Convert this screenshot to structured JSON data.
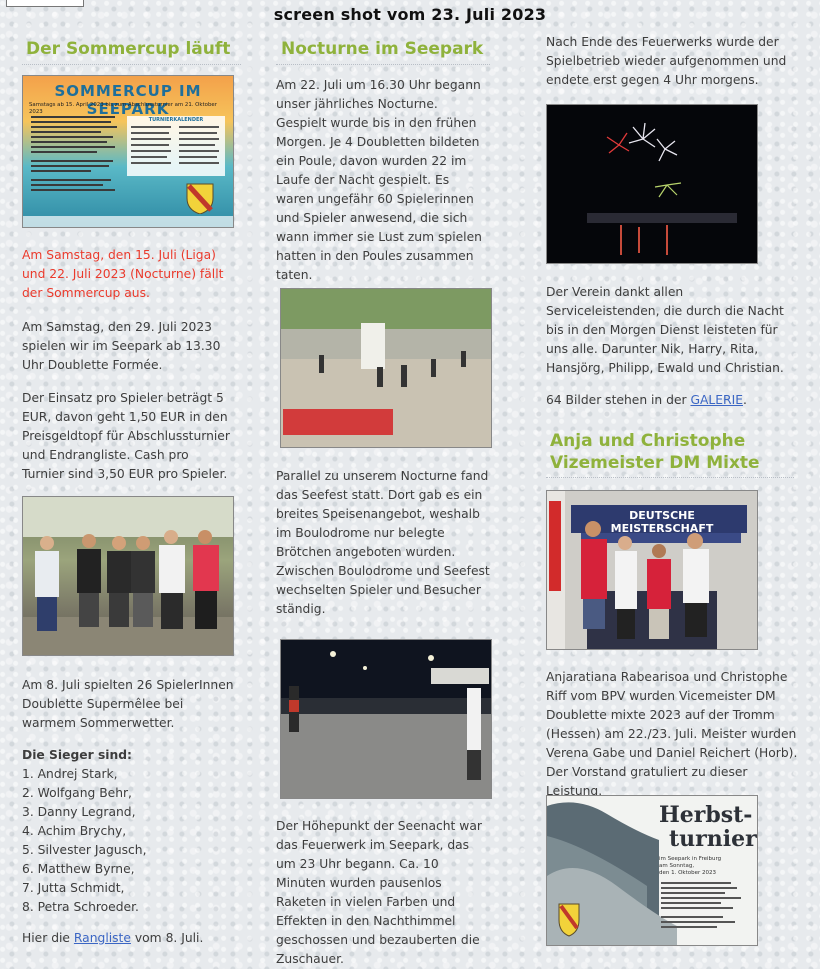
{
  "caption": "screen shot vom 23. Juli 2023",
  "col1": {
    "heading": "Der Sommercup läuft",
    "poster": {
      "title": "SOMMERCUP IM SEEPARK",
      "subtitle": "Samstags ab 15. April 2023 bis zum Abschlussturnier am 21. Oktober 2023",
      "table_title": "TURNIERKALENDER"
    },
    "red_notice": "Am Samstag, den 15. Juli (Liga) und 22. Juli 2023 (Nocturne) fällt der Sommercup aus.",
    "p1": "Am Samstag, den 29. Juli 2023 spielen wir im Seepark ab 13.30 Uhr Doublette Formée.",
    "p2": "Der Einsatz pro Spieler beträgt 5 EUR, davon geht 1,50 EUR in den Preisgeldtopf für Abschlussturnier und Endrangliste. Cash pro Turnier sind 3,50 EUR pro Spieler.",
    "p3": "Am 8. Juli spielten 26 SpielerInnen Doublette Supermêlee bei warmem Sommerwetter.",
    "winners_title": "Die Sieger sind:",
    "winners": [
      "1. Andrej Stark,",
      "2. Wolfgang Behr,",
      "3. Danny Legrand,",
      "4. Achim Brychy,",
      "5. Silvester Jagusch,",
      "6. Matthew Byrne,",
      "7. Jutta Schmidt,",
      "8. Petra Schroeder."
    ],
    "ranking_prefix": "Hier die",
    "ranking_link": "Rangliste",
    "ranking_suffix": "vom 8. Juli."
  },
  "col2": {
    "heading": "Nocturne im Seepark",
    "p1": "Am 22. Juli um 16.30 Uhr begann unser jährliches Nocturne. Gespielt wurde bis in den frühen Morgen. Je 4 Doubletten bildeten ein Poule, davon wurden 22 im Laufe der Nacht gespielt. Es waren ungefähr 60 Spielerinnen und Spieler anwesend, die sich wann immer sie Lust zum spielen hatten in den Poules zusammen taten.",
    "p2": "Parallel zu unserem Nocturne fand das Seefest statt. Dort gab es ein breites Speisenangebot, weshalb im Boulodrome nur belegte Brötchen angeboten wurden. Zwischen Boulodrome und Seefest wechselten Spieler und Besucher ständig.",
    "p3": "Der Höhepunkt der Seenacht war das Feuerwerk im Seepark, das um 23 Uhr begann. Ca. 10 Minuten wurden pausenlos Raketen in vielen Farben und Effekten in den Nachthimmel geschossen und bezauberten die Zuschauer."
  },
  "col3": {
    "p1": "Nach Ende des Feuerwerks wurde der Spielbetrieb wieder aufgenommen und endete erst gegen 4 Uhr morgens.",
    "p2": "Der Verein dankt allen Serviceleistenden, die durch die Nacht bis in den Morgen Dienst leisteten für uns alle. Darunter Nik, Harry, Rita, Hansjörg, Philipp, Ewald und Christian.",
    "gallery_prefix": "64 Bilder stehen in der",
    "gallery_link": "GALERIE",
    "gallery_suffix": ".",
    "heading": "Anja und Christophe Vizemeister DM Mixte",
    "banner": "DEUTSCHE MEISTERSCHAFT",
    "p3": "Anjaratiana Rabearisoa und Christophe Riff vom BPV wurden Vicemeister DM Doublette mixte 2023 auf der Tromm (Hessen) am 22./23. Juli. Meister wurden Verena Gabe und Daniel Reichert (Horb). Der Vorstand gratuliert zu dieser Leistung.",
    "poster": {
      "title1": "Herbst-",
      "title2": "turnier",
      "line1": "im Seepark in Freiburg",
      "line2": "am Sonntag,",
      "line3": "den 1. Oktober 2023"
    }
  },
  "colors": {
    "heading": "#8fb23c",
    "link": "#3b66c4",
    "alert": "#ea3a2c"
  }
}
